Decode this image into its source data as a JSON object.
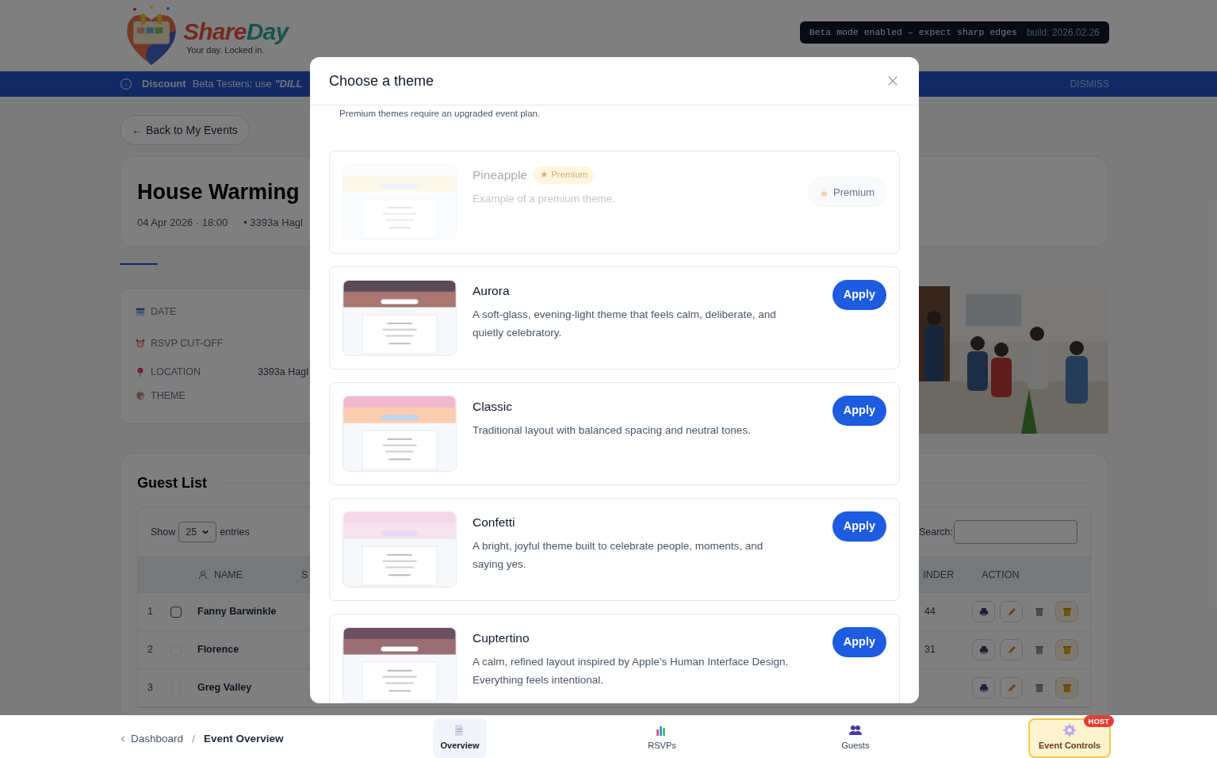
{
  "header": {
    "brand_parts": [
      "Share",
      "Day"
    ],
    "tagline": "Your day. Locked in.",
    "beta_message": "Beta mode enabled – expect sharp edges",
    "build": "build: 2026.02.26"
  },
  "banner": {
    "label": "Discount",
    "text": "Beta Testers: use ",
    "code": "\"DILL",
    "dismiss": "DISMISS"
  },
  "back_button": "← Back to My Events",
  "event": {
    "title": "House Warming",
    "date": "04 Apr 2026 · 18:00",
    "location": "• 3393a Hagl"
  },
  "details": [
    {
      "kind": "calendar",
      "label": "DATE"
    },
    {
      "kind": "alarm",
      "label": "RSVP CUT-OFF"
    },
    {
      "kind": "pin",
      "label": "LOCATION",
      "value": "3393a Hagl"
    },
    {
      "kind": "palette",
      "label": "THEME"
    }
  ],
  "guest_list": {
    "title": "Guest List",
    "show_label": "Show",
    "page_size": "25",
    "entries_label": "entries",
    "search_label": "Search:",
    "columns": [
      "NAME",
      "S",
      "INDER",
      "ACTION"
    ],
    "rows": [
      {
        "number": "1",
        "name": "Fanny Barwinkle",
        "checked": false,
        "reminder": "44"
      },
      {
        "number": "2",
        "name": "Florence",
        "checked": false,
        "reminder": "31"
      },
      {
        "number": "3",
        "name": "Greg Valley",
        "checked": false
      }
    ]
  },
  "bottom_nav": {
    "breadcrumb": [
      {
        "text": "Dashboard"
      },
      {
        "text": "Event Overview"
      }
    ],
    "tabs": [
      {
        "label": "Overview",
        "kind": "page",
        "selected": true
      },
      {
        "label": "RSVPs",
        "kind": "chart",
        "selected": false
      },
      {
        "label": "Guests",
        "kind": "people",
        "selected": false
      },
      {
        "label": "Event Controls",
        "kind": "gear",
        "selected": false,
        "badge": "HOST"
      }
    ]
  },
  "modal": {
    "title": "Choose a theme",
    "note": "Premium themes require an upgraded event plan.",
    "themes": [
      {
        "name": "Pineapple",
        "badge": "★ Premium",
        "description": "Example of a premium theme.",
        "action": "Premium",
        "disabled": true
      },
      {
        "name": "Aurora",
        "description": "A soft-glass, evening-light theme that feels calm, deliberate, and quietly celebratory.",
        "action": "Apply",
        "disabled": false
      },
      {
        "name": "Classic",
        "description": "Traditional layout with balanced spacing and neutral tones.",
        "action": "Apply",
        "disabled": false
      },
      {
        "name": "Confetti",
        "description": "A bright, joyful theme built to celebrate people, moments, and saying yes.",
        "action": "Apply",
        "disabled": false
      },
      {
        "name": "Cuptertino",
        "description": "A calm, refined layout inspired by Apple’s Human Interface Design. Everything feels intentional.",
        "action": "Apply",
        "disabled": false
      }
    ]
  }
}
